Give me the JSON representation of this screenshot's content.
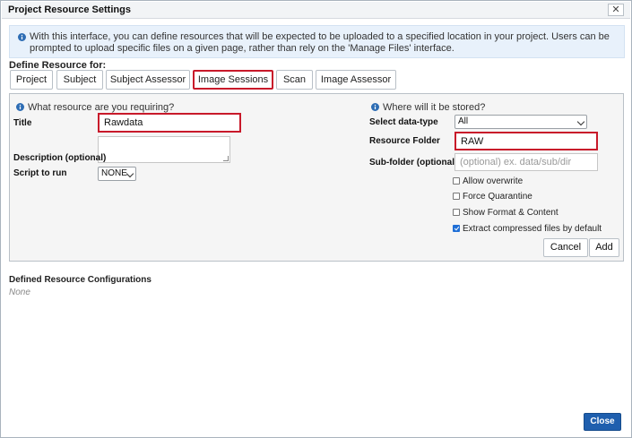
{
  "window": {
    "title": "Project Resource Settings",
    "close_glyph": "✕"
  },
  "info": {
    "text": "With this interface, you can define resources that will be expected to be uploaded to a specified location in your project. Users can be prompted to upload specific files on a given page, rather than rely on the 'Manage Files' interface.",
    "icon": "info-icon"
  },
  "define": {
    "label": "Define Resource for:",
    "tabs": [
      "Project",
      "Subject",
      "Subject Assessor",
      "Image Sessions",
      "Scan",
      "Image Assessor"
    ],
    "active_tab": "Image Sessions"
  },
  "left": {
    "heading": "What resource are you requiring?",
    "title_label": "Title",
    "title_value": "Rawdata",
    "description_label": "Description (optional)",
    "description_value": "",
    "script_label": "Script to run",
    "script_value": "NONE"
  },
  "right": {
    "heading": "Where will it be stored?",
    "datatype_label": "Select data-type",
    "datatype_value": "All",
    "folder_label": "Resource Folder",
    "folder_value": "RAW",
    "subfolder_label": "Sub-folder (optional)",
    "subfolder_placeholder": "(optional) ex. data/sub/dir",
    "options": [
      {
        "label": "Allow overwrite",
        "checked": false
      },
      {
        "label": "Force Quarantine",
        "checked": false
      },
      {
        "label": "Show Format & Content",
        "checked": false
      },
      {
        "label": "Extract compressed files by default",
        "checked": true
      }
    ],
    "cancel_label": "Cancel",
    "add_label": "Add"
  },
  "defined": {
    "label": "Defined Resource Configurations",
    "none_text": "None"
  },
  "footer": {
    "close_label": "Close"
  },
  "colors": {
    "highlight_red": "#c8192a",
    "primary_blue": "#1f5fae",
    "info_bg": "#e8f1fb",
    "info_icon": "#2e6db4"
  }
}
